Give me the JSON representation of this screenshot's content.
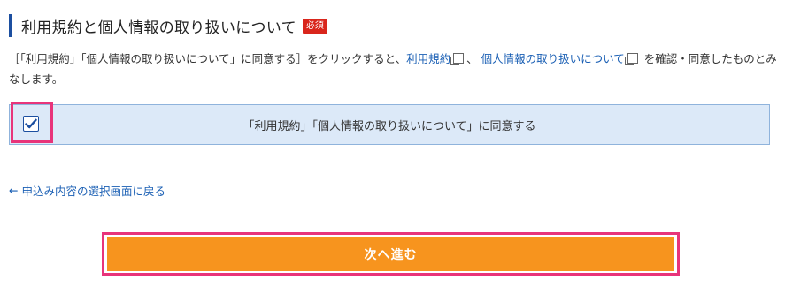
{
  "section": {
    "title": "利用規約と個人情報の取り扱いについて",
    "required_badge": "必須"
  },
  "description": {
    "text_before": "［「利用規約」「個人情報の取り扱いについて」に同意する］をクリックすると、",
    "link_terms": "利用規約",
    "separator": "、",
    "link_privacy": "個人情報の取り扱いについて",
    "text_after": "を確認・同意したものとみなします。"
  },
  "agree": {
    "label": "「利用規約」「個人情報の取り扱いについて」に同意する",
    "checked": true
  },
  "back_link": {
    "arrow": "←",
    "label": "申込み内容の選択画面に戻る"
  },
  "next_button": {
    "label": "次へ進む"
  },
  "colors": {
    "accent_blue": "#1c4fa0",
    "link_blue": "#1a5fb4",
    "badge_red": "#d9261c",
    "agree_bg": "#dce9f8",
    "button_orange": "#f7941e",
    "highlight_pink": "#e8347a"
  }
}
